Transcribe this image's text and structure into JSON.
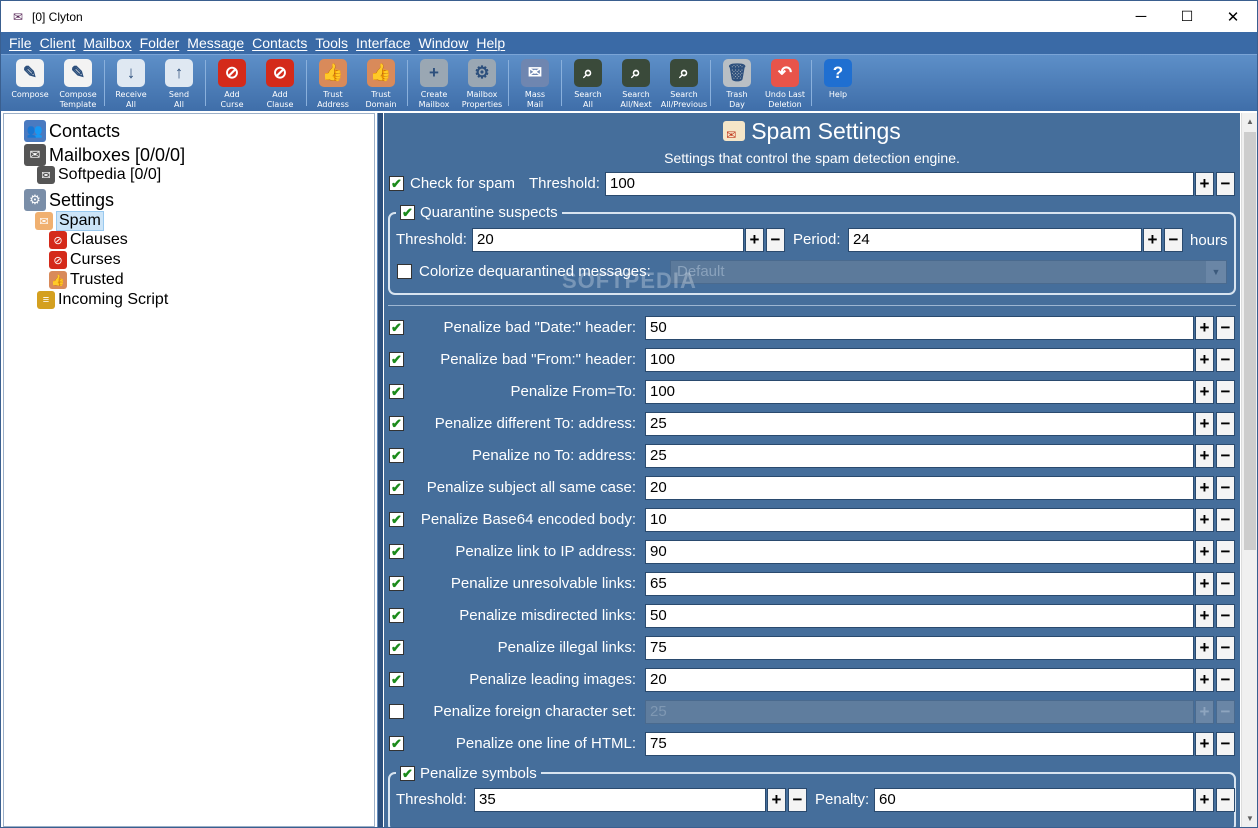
{
  "window": {
    "title": "[0] Clyton",
    "controls": [
      "─",
      "☐",
      "✕"
    ]
  },
  "menu": [
    "File",
    "Client",
    "Mailbox",
    "Folder",
    "Message",
    "Contacts",
    "Tools",
    "Interface",
    "Window",
    "Help"
  ],
  "toolbar": [
    {
      "label": "Compose",
      "icon": "compose-icon",
      "color": "#f3f3f3",
      "glyph": "✎"
    },
    {
      "label": "Compose\nTemplate",
      "icon": "compose-template-icon",
      "color": "#f3f3f3",
      "glyph": "✎"
    },
    {
      "label": "Receive\nAll",
      "icon": "receive-all-icon",
      "color": "#dfe8f2",
      "glyph": "↓"
    },
    {
      "label": "Send\nAll",
      "icon": "send-all-icon",
      "color": "#dfe8f2",
      "glyph": "↑"
    },
    {
      "label": "Add\nCurse",
      "icon": "add-curse-icon",
      "color": "#d42a1a",
      "glyph": "⊘"
    },
    {
      "label": "Add\nClause",
      "icon": "add-clause-icon",
      "color": "#d42a1a",
      "glyph": "⊘"
    },
    {
      "label": "Trust\nAddress",
      "icon": "trust-address-icon",
      "color": "#d98a5a",
      "glyph": "👍"
    },
    {
      "label": "Trust\nDomain",
      "icon": "trust-domain-icon",
      "color": "#d98a5a",
      "glyph": "👍"
    },
    {
      "label": "Create\nMailbox",
      "icon": "create-mailbox-icon",
      "color": "#9aa7b3",
      "glyph": "+"
    },
    {
      "label": "Mailbox\nProperties",
      "icon": "mailbox-properties-icon",
      "color": "#9aa7b3",
      "glyph": "⚙"
    },
    {
      "label": "Mass\nMail",
      "icon": "mass-mail-icon",
      "color": "#6f86b0",
      "glyph": "✉"
    },
    {
      "label": "Search\nAll",
      "icon": "search-all-icon",
      "color": "#3a4a3a",
      "glyph": "⌕"
    },
    {
      "label": "Search\nAll/Next",
      "icon": "search-next-icon",
      "color": "#3a4a3a",
      "glyph": "⌕"
    },
    {
      "label": "Search\nAll/Previous",
      "icon": "search-previous-icon",
      "color": "#3a4a3a",
      "glyph": "⌕"
    },
    {
      "label": "Trash\nDay",
      "icon": "trash-icon",
      "color": "#b9bfc4",
      "glyph": "🗑"
    },
    {
      "label": "Undo Last\nDeletion",
      "icon": "undo-deletion-icon",
      "color": "#e8544a",
      "glyph": "↶"
    },
    {
      "label": "Help",
      "icon": "help-icon",
      "color": "#1f6fd1",
      "glyph": "?"
    }
  ],
  "tree": [
    {
      "label": "Contacts",
      "icon": "contacts-icon",
      "level": 0
    },
    {
      "label": "Mailboxes [0/0/0]",
      "icon": "mailboxes-icon",
      "level": 0
    },
    {
      "label": "Softpedia [0/0]",
      "icon": "mailbox-icon",
      "level": 1
    },
    {
      "label": "Settings",
      "icon": "settings-icon",
      "level": 0
    },
    {
      "label": "Spam",
      "icon": "spam-icon",
      "level": 1,
      "selected": true
    },
    {
      "label": "Clauses",
      "icon": "clauses-icon",
      "level": 2
    },
    {
      "label": "Curses",
      "icon": "curses-icon",
      "level": 2
    },
    {
      "label": "Trusted",
      "icon": "trusted-icon",
      "level": 2
    },
    {
      "label": "Incoming Script",
      "icon": "script-icon",
      "level": 1
    }
  ],
  "panel": {
    "title": "Spam Settings",
    "subtitle": "Settings that control the spam detection engine.",
    "check_spam": {
      "label": "Check for spam",
      "checked": true,
      "threshold_label": "Threshold:",
      "threshold": "100"
    },
    "quarantine": {
      "label": "Quarantine suspects",
      "checked": true,
      "threshold_label": "Threshold:",
      "threshold": "20",
      "period_label": "Period:",
      "period": "24",
      "period_unit": "hours",
      "colorize_label": "Colorize dequarantined messages:",
      "colorize_checked": false,
      "colorize_value": "Default"
    },
    "penalties": [
      {
        "label": "Penalize bad \"Date:\" header:",
        "value": "50",
        "checked": true
      },
      {
        "label": "Penalize bad \"From:\" header:",
        "value": "100",
        "checked": true
      },
      {
        "label": "Penalize From=To:",
        "value": "100",
        "checked": true
      },
      {
        "label": "Penalize different To: address:",
        "value": "25",
        "checked": true
      },
      {
        "label": "Penalize no To: address:",
        "value": "25",
        "checked": true
      },
      {
        "label": "Penalize subject all same case:",
        "value": "20",
        "checked": true
      },
      {
        "label": "Penalize Base64 encoded body:",
        "value": "10",
        "checked": true
      },
      {
        "label": "Penalize link to IP address:",
        "value": "90",
        "checked": true
      },
      {
        "label": "Penalize unresolvable links:",
        "value": "65",
        "checked": true
      },
      {
        "label": "Penalize misdirected links:",
        "value": "50",
        "checked": true
      },
      {
        "label": "Penalize illegal links:",
        "value": "75",
        "checked": true
      },
      {
        "label": "Penalize leading images:",
        "value": "20",
        "checked": true
      },
      {
        "label": "Penalize foreign character set:",
        "value": "25",
        "checked": false
      },
      {
        "label": "Penalize one line of HTML:",
        "value": "75",
        "checked": true
      }
    ],
    "symbols": {
      "label": "Penalize symbols",
      "checked": true,
      "threshold_label": "Threshold:",
      "threshold": "35",
      "penalty_label": "Penalty:",
      "penalty": "60"
    }
  },
  "watermark": "SOFTPEDIA",
  "colors": {
    "menubar": "#3a6aa6",
    "panel": "#456e9b",
    "selection": "#cce4f7"
  }
}
